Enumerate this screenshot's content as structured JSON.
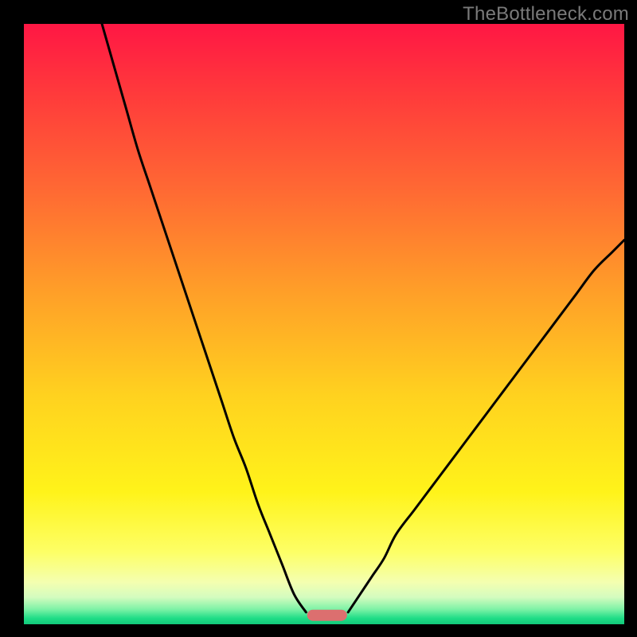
{
  "attribution": "TheBottleneck.com",
  "chart_data": {
    "type": "line",
    "title": "",
    "xlabel": "",
    "ylabel": "",
    "xlim": [
      0,
      100
    ],
    "ylim": [
      0,
      100
    ],
    "grid": false,
    "series": [
      {
        "name": "left-branch",
        "x": [
          13,
          15,
          17,
          19,
          21,
          23,
          25,
          27,
          29,
          31,
          33,
          35,
          37,
          39,
          41,
          43,
          45,
          47
        ],
        "values": [
          100,
          93,
          86,
          79,
          73,
          67,
          61,
          55,
          49,
          43,
          37,
          31,
          26,
          20,
          15,
          10,
          5,
          2
        ]
      },
      {
        "name": "right-branch",
        "x": [
          54,
          56,
          58,
          60,
          62,
          65,
          68,
          71,
          74,
          77,
          80,
          83,
          86,
          89,
          92,
          95,
          98,
          100
        ],
        "values": [
          2,
          5,
          8,
          11,
          15,
          19,
          23,
          27,
          31,
          35,
          39,
          43,
          47,
          51,
          55,
          59,
          62,
          64
        ]
      }
    ],
    "optimum_marker": {
      "x": 50.5,
      "y": 1.5,
      "color": "#dc6f6f"
    },
    "gradient_stops": [
      {
        "offset": 0.0,
        "color": "#ff1744"
      },
      {
        "offset": 0.12,
        "color": "#ff3b3b"
      },
      {
        "offset": 0.28,
        "color": "#ff6a33"
      },
      {
        "offset": 0.45,
        "color": "#ffa028"
      },
      {
        "offset": 0.62,
        "color": "#ffd21f"
      },
      {
        "offset": 0.78,
        "color": "#fff31a"
      },
      {
        "offset": 0.88,
        "color": "#fdff66"
      },
      {
        "offset": 0.93,
        "color": "#f4ffb0"
      },
      {
        "offset": 0.955,
        "color": "#d4fcbf"
      },
      {
        "offset": 0.975,
        "color": "#7ef2a6"
      },
      {
        "offset": 0.99,
        "color": "#1fdd87"
      },
      {
        "offset": 1.0,
        "color": "#12c97b"
      }
    ]
  }
}
